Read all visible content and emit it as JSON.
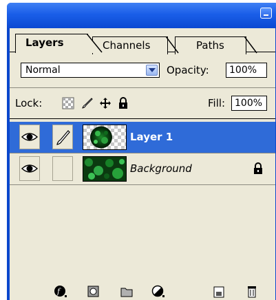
{
  "tabs": [
    {
      "label": "Layers",
      "active": true
    },
    {
      "label": "Channels",
      "active": false
    },
    {
      "label": "Paths",
      "active": false
    }
  ],
  "blend_mode": {
    "selected": "Normal"
  },
  "opacity": {
    "label": "Opacity:",
    "value": "100%"
  },
  "lock": {
    "label": "Lock:",
    "icons": [
      "transparency-lock-icon",
      "brush-lock-icon",
      "move-lock-icon",
      "padlock-icon"
    ]
  },
  "fill": {
    "label": "Fill:",
    "value": "100%"
  },
  "layers": [
    {
      "name": "Layer 1",
      "selected": true,
      "visible": true,
      "linked_brush": true
    },
    {
      "name": "Background",
      "selected": false,
      "visible": true,
      "locked": true
    }
  ],
  "bottom_tools": [
    "layer-style-icon",
    "mask-icon",
    "folder-icon",
    "adjustment-layer-icon",
    "new-layer-icon",
    "trash-icon"
  ],
  "colors": {
    "titlebar": "#1a5ee8",
    "panel": "#ece9d8",
    "selection": "#2f6bd8"
  }
}
